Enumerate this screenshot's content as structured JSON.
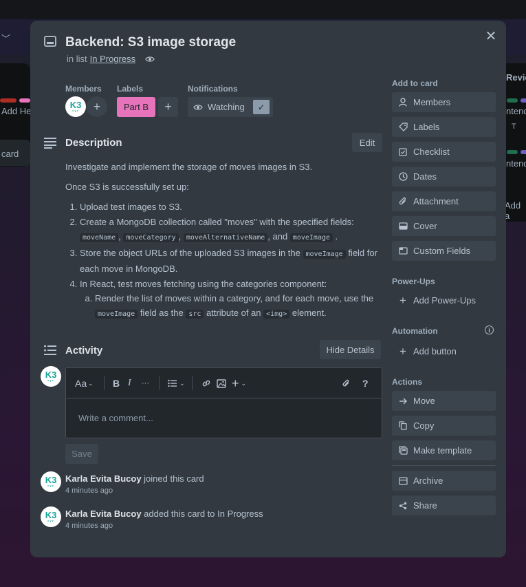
{
  "background": {
    "left_list_texts": [
      "Add He",
      "card"
    ],
    "right_list_texts": [
      "Review",
      "ntend",
      "T",
      "ntend",
      "Add a"
    ]
  },
  "card": {
    "title": "Backend: S3 image storage",
    "in_list_prefix": "in list",
    "list_name": "In Progress"
  },
  "members": {
    "label": "Members",
    "avatar_initials": "K3",
    "avatar_sub": "cyz"
  },
  "labels": {
    "label": "Labels",
    "items": [
      "Part B"
    ]
  },
  "notifications": {
    "label": "Notifications",
    "watch_label": "Watching",
    "watching": true
  },
  "description": {
    "title": "Description",
    "edit_label": "Edit",
    "intro": "Investigate and implement the storage of moves images in S3.",
    "intro2": "Once S3 is successfully set up:",
    "step1": "Upload test images to S3.",
    "step2_text": "Create a MongoDB collection called \"moves\" with the specified fields:",
    "step2_fields": [
      "moveName",
      "moveCategory",
      "moveAlternativeName",
      "moveImage"
    ],
    "step2_and": ", and",
    "step3_before": "Store the object URLs of the uploaded S3 images in the",
    "step3_code": "moveImage",
    "step3_after": "field for each move in MongoDB.",
    "step4": "In React, test moves fetching using the categories component:",
    "step4a_before": "Render the list of moves within a category, and for each move, use the",
    "step4a_code1": "moveImage",
    "step4a_mid": "field as the",
    "step4a_code2": "src",
    "step4a_mid2": "attribute of an",
    "step4a_code3": "<img>",
    "step4a_end": "element."
  },
  "activity": {
    "title": "Activity",
    "hide_details_label": "Hide Details",
    "toolbar": {
      "text_style": "Aa",
      "bold": "B",
      "italic": "I",
      "more": "···",
      "help": "?"
    },
    "comment_placeholder": "Write a comment...",
    "save_label": "Save",
    "items": [
      {
        "user": "Karla Evita Bucoy",
        "action": "joined this card",
        "time": "4 minutes ago"
      },
      {
        "user": "Karla Evita Bucoy",
        "action": "added this card to In Progress",
        "time": "4 minutes ago"
      }
    ]
  },
  "sidebar": {
    "add_to_card": "Add to card",
    "add_items": [
      "Members",
      "Labels",
      "Checklist",
      "Dates",
      "Attachment",
      "Cover",
      "Custom Fields"
    ],
    "powerups_head": "Power-Ups",
    "add_powerups": "Add Power-Ups",
    "automation_head": "Automation",
    "add_button": "Add button",
    "actions_head": "Actions",
    "actions": [
      "Move",
      "Copy",
      "Make template",
      "Archive",
      "Share"
    ]
  },
  "colors": {
    "modal_bg": "#323940",
    "label_part_b": "#e774bb",
    "button_bg": "#3b444c",
    "avatar_teal": "#1aa39a"
  }
}
